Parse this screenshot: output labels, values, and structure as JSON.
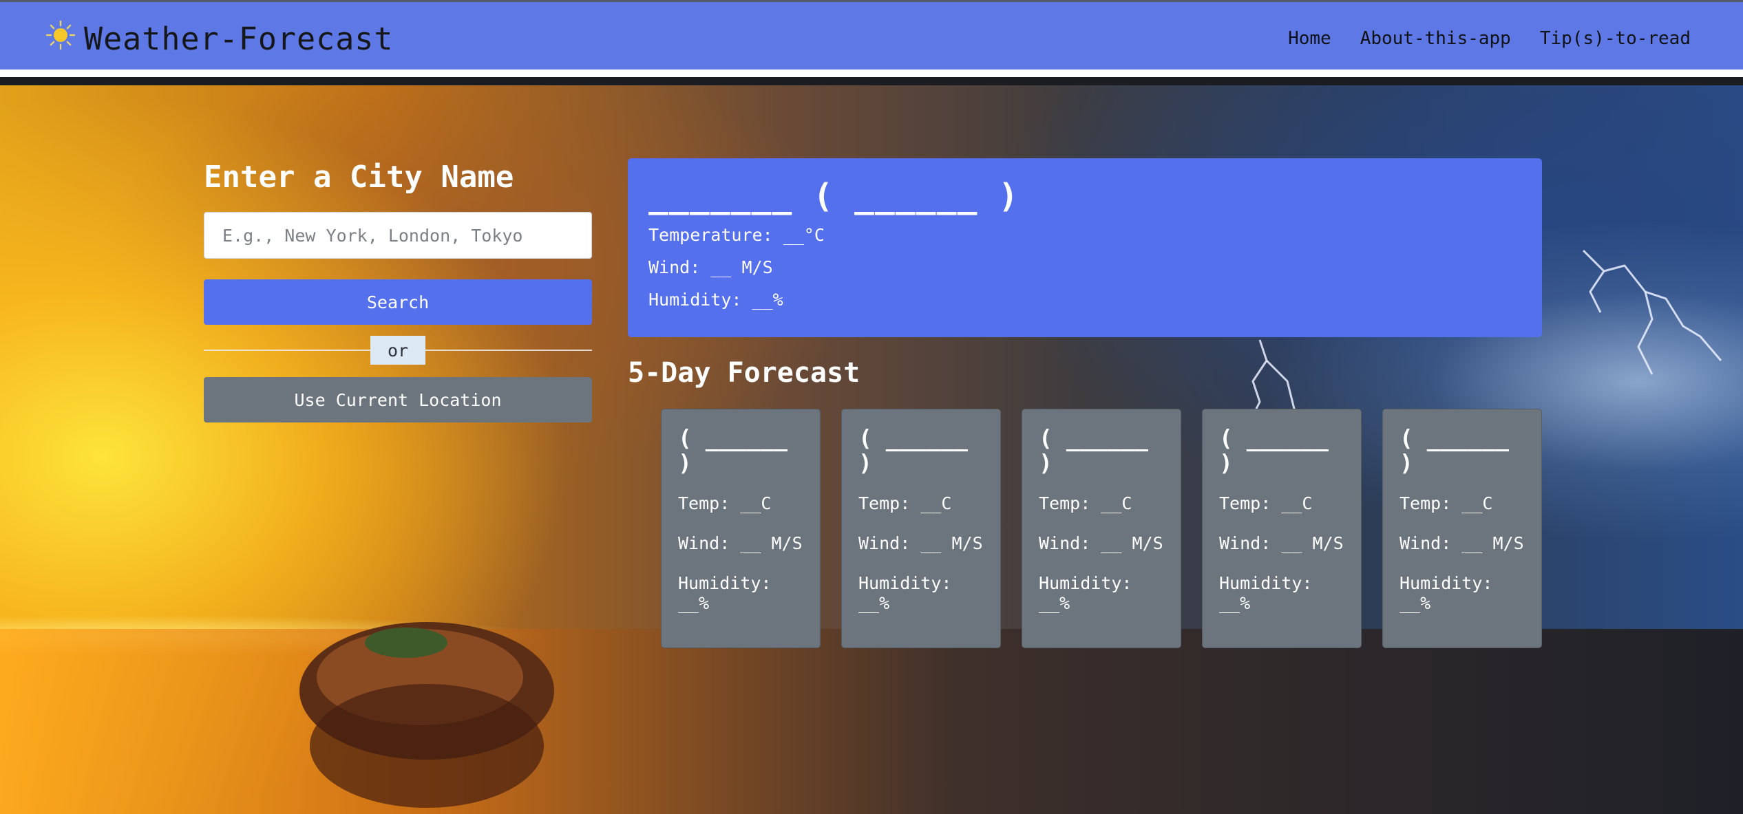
{
  "navbar": {
    "brand_icon": "sun-icon",
    "brand_title": "Weather-Forecast",
    "links": [
      "Home",
      "About-this-app",
      "Tip(s)-to-read"
    ]
  },
  "search": {
    "title": "Enter a City Name",
    "placeholder": "E.g., New York, London, Tokyo",
    "search_label": "Search",
    "or_label": "or",
    "location_label": "Use Current Location"
  },
  "current": {
    "city": "_______ ( ______ )",
    "temperature": "Temperature: __°C",
    "wind": "Wind: __ M/S",
    "humidity": "Humidity: __%"
  },
  "forecast": {
    "title": "5-Day Forecast",
    "days": [
      {
        "date": "( ______ )",
        "temp": "Temp: __C",
        "wind": "Wind: __ M/S",
        "humidity": "Humidity: __%"
      },
      {
        "date": "( ______ )",
        "temp": "Temp: __C",
        "wind": "Wind: __ M/S",
        "humidity": "Humidity: __%"
      },
      {
        "date": "( ______ )",
        "temp": "Temp: __C",
        "wind": "Wind: __ M/S",
        "humidity": "Humidity: __%"
      },
      {
        "date": "( ______ )",
        "temp": "Temp: __C",
        "wind": "Wind: __ M/S",
        "humidity": "Humidity: __%"
      },
      {
        "date": "( ______ )",
        "temp": "Temp: __C",
        "wind": "Wind: __ M/S",
        "humidity": "Humidity: __%"
      }
    ]
  },
  "colors": {
    "navbar": "#5e79e6",
    "primary": "#5470ec",
    "secondary": "#6c757d"
  }
}
